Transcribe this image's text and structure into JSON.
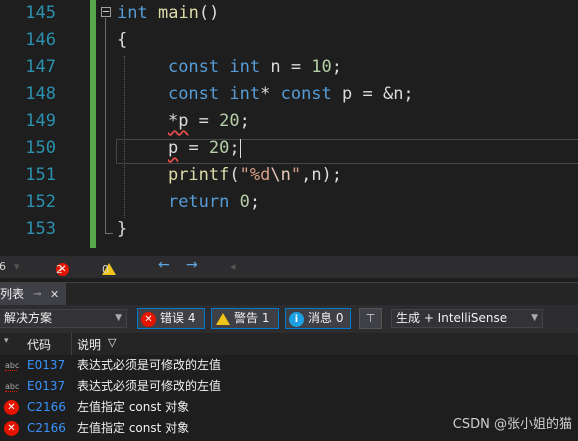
{
  "editor": {
    "line_numbers": [
      "145",
      "146",
      "147",
      "148",
      "149",
      "150",
      "151",
      "152",
      "153"
    ],
    "lines": [
      [
        {
          "t": "int",
          "c": "kw"
        },
        {
          "t": " "
        },
        {
          "t": "main",
          "c": "fn"
        },
        {
          "t": "()"
        }
      ],
      [
        {
          "t": "{"
        }
      ],
      [
        {
          "t": "    "
        },
        {
          "t": "const",
          "c": "kw"
        },
        {
          "t": " "
        },
        {
          "t": "int",
          "c": "kw"
        },
        {
          "t": " n = "
        },
        {
          "t": "10",
          "c": "num"
        },
        {
          "t": ";"
        }
      ],
      [
        {
          "t": "    "
        },
        {
          "t": "const",
          "c": "kw"
        },
        {
          "t": " "
        },
        {
          "t": "int",
          "c": "kw"
        },
        {
          "t": "* "
        },
        {
          "t": "const",
          "c": "kw"
        },
        {
          "t": " p = &n;"
        }
      ],
      [
        {
          "t": "    "
        },
        {
          "t": "*p",
          "c": "squig"
        },
        {
          "t": " = "
        },
        {
          "t": "20",
          "c": "num"
        },
        {
          "t": ";"
        }
      ],
      [
        {
          "t": "    "
        },
        {
          "t": "p",
          "c": "squig"
        },
        {
          "t": " = "
        },
        {
          "t": "20",
          "c": "num"
        },
        {
          "t": ";"
        },
        {
          "t": "",
          "c": "caret"
        }
      ],
      [
        {
          "t": "    "
        },
        {
          "t": "printf",
          "c": "fn"
        },
        {
          "t": "("
        },
        {
          "t": "\"%d",
          "c": "str"
        },
        {
          "t": "\\n",
          "c": "esc"
        },
        {
          "t": "\"",
          "c": "str"
        },
        {
          "t": ",n);"
        }
      ],
      [
        {
          "t": "    "
        },
        {
          "t": "return",
          "c": "kw"
        },
        {
          "t": " "
        },
        {
          "t": "0",
          "c": "num"
        },
        {
          "t": ";"
        }
      ],
      [
        {
          "t": "}"
        }
      ]
    ]
  },
  "status": {
    "zoom_partial": "6",
    "errors": "2",
    "warnings": "0",
    "nav_back": "←",
    "nav_fwd": "→"
  },
  "panel": {
    "tab_label": "列表",
    "pin": "⊸",
    "close": "✕",
    "scope_value": "解决方案",
    "errors_btn": "错误 4",
    "warnings_btn": "警告 1",
    "messages_btn": "消息 0",
    "build_value": "生成 + IntelliSense",
    "col_code": "代码",
    "col_desc": "说明",
    "rows": [
      {
        "icon": "abc-icon",
        "code": "E0137",
        "desc": "表达式必须是可修改的左值"
      },
      {
        "icon": "abc-icon",
        "code": "E0137",
        "desc": "表达式必须是可修改的左值"
      },
      {
        "icon": "error-icon",
        "code": "C2166",
        "desc": "左值指定 const 对象"
      },
      {
        "icon": "error-icon",
        "code": "C2166",
        "desc": "左值指定 const 对象"
      }
    ]
  },
  "watermark": "CSDN @张小姐的猫",
  "colors": {
    "keyword": "#569cd6",
    "function": "#dcdcaa",
    "number": "#b5cea8",
    "string": "#d69d85",
    "line_number": "#2b91af",
    "link": "#3794ff",
    "error": "#e51400",
    "warning": "#f0c419"
  }
}
